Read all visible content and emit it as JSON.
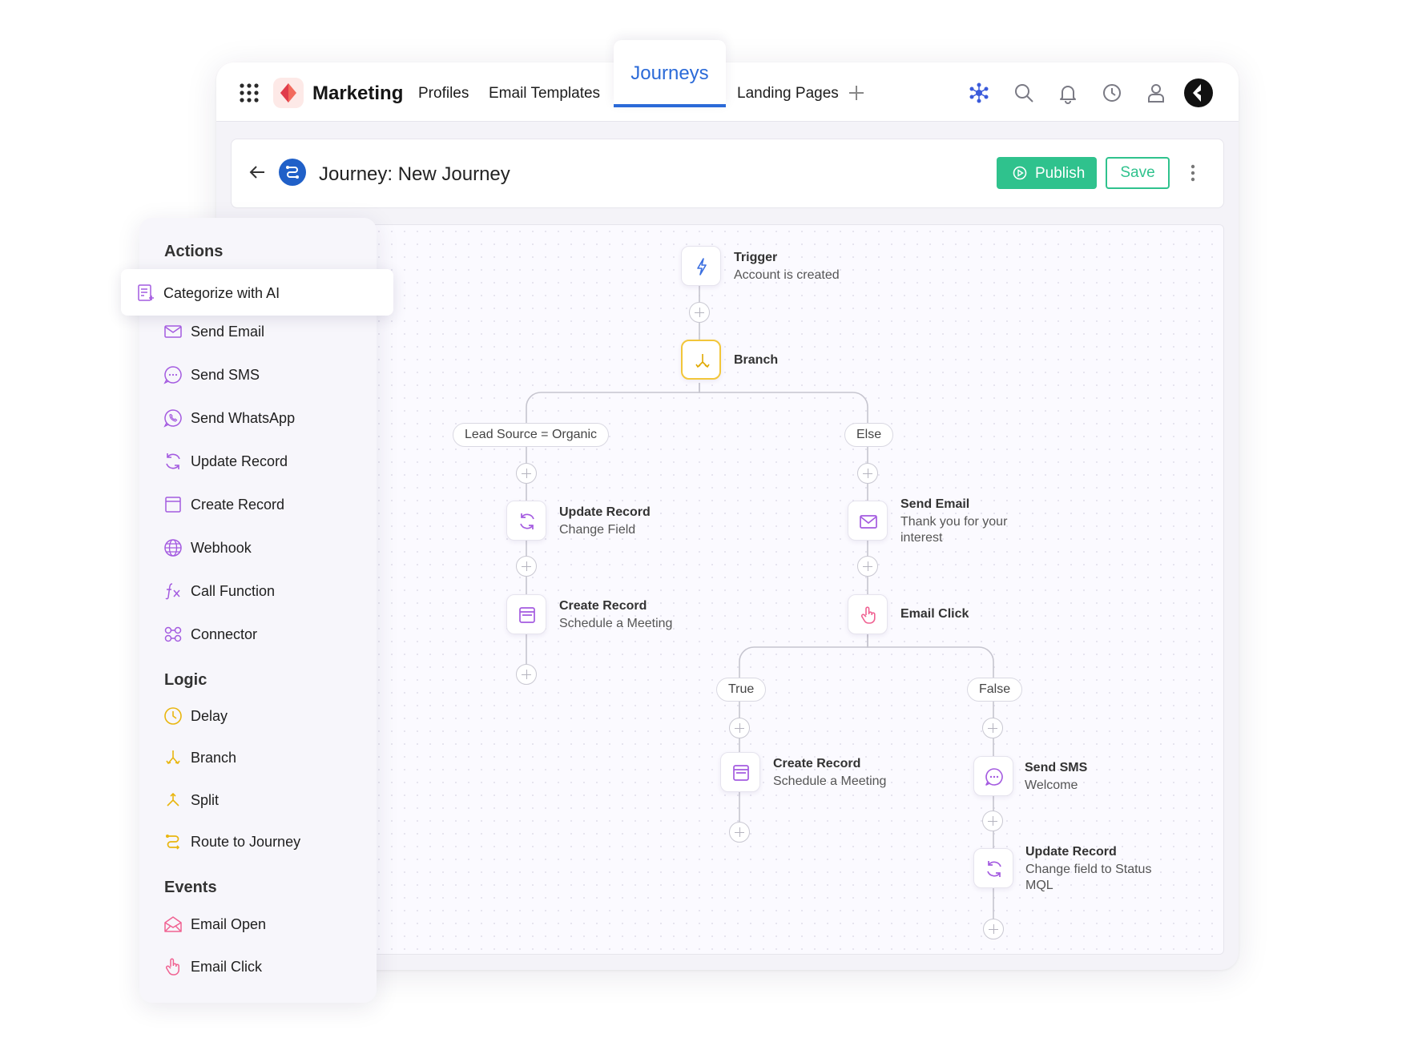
{
  "topbar": {
    "brand": "Marketing",
    "nav": [
      "Profiles",
      "Email Templates",
      "Journeys",
      "Landing Pages"
    ],
    "active_tab": "Journeys",
    "icons": [
      "apps-grid-icon",
      "network-icon",
      "search-icon",
      "bell-icon",
      "clock-icon",
      "user-icon",
      "brand-app-icon"
    ]
  },
  "header": {
    "title": "Journey: New Journey",
    "publish_label": "Publish",
    "save_label": "Save"
  },
  "palette": {
    "actions_heading": "Actions",
    "actions": [
      {
        "label": "Categorize with AI",
        "icon": "ai-categorize-icon"
      },
      {
        "label": "Send Email",
        "icon": "envelope-icon"
      },
      {
        "label": "Send SMS",
        "icon": "chat-bubble-icon"
      },
      {
        "label": "Send WhatsApp",
        "icon": "whatsapp-icon"
      },
      {
        "label": "Update Record",
        "icon": "refresh-icon"
      },
      {
        "label": "Create Record",
        "icon": "record-icon"
      },
      {
        "label": "Webhook",
        "icon": "globe-icon"
      },
      {
        "label": "Call Function",
        "icon": "function-icon"
      },
      {
        "label": "Connector",
        "icon": "connector-icon"
      }
    ],
    "logic_heading": "Logic",
    "logic": [
      {
        "label": "Delay",
        "icon": "clock-icon"
      },
      {
        "label": "Branch",
        "icon": "branch-icon"
      },
      {
        "label": "Split",
        "icon": "split-icon"
      },
      {
        "label": "Route to Journey",
        "icon": "route-icon"
      }
    ],
    "events_heading": "Events",
    "events": [
      {
        "label": "Email Open",
        "icon": "open-envelope-icon"
      },
      {
        "label": "Email Click",
        "icon": "pointer-hand-icon"
      }
    ]
  },
  "flow": {
    "trigger": {
      "title": "Trigger",
      "subtitle": "Account is created"
    },
    "branch": {
      "title": "Branch"
    },
    "conditions": {
      "left": "Lead Source = Organic",
      "right": "Else",
      "true": "True",
      "false": "False"
    },
    "left_steps": [
      {
        "title": "Update Record",
        "subtitle": "Change Field"
      },
      {
        "title": "Create Record",
        "subtitle": "Schedule a Meeting"
      }
    ],
    "right_steps": [
      {
        "title": "Send Email",
        "subtitle": "Thank you for your interest"
      },
      {
        "title": "Email Click",
        "subtitle": ""
      }
    ],
    "true_steps": [
      {
        "title": "Create Record",
        "subtitle": "Schedule a Meeting"
      }
    ],
    "false_steps": [
      {
        "title": "Send SMS",
        "subtitle": "Welcome"
      },
      {
        "title": "Update Record",
        "subtitle": "Change field to Status MQL"
      }
    ]
  },
  "colors": {
    "accent_blue": "#2b6ad8",
    "publish_green": "#2fc28d",
    "icon_purple": "#a45be0",
    "branch_yellow": "#f2c63a",
    "event_pink": "#f06292"
  }
}
